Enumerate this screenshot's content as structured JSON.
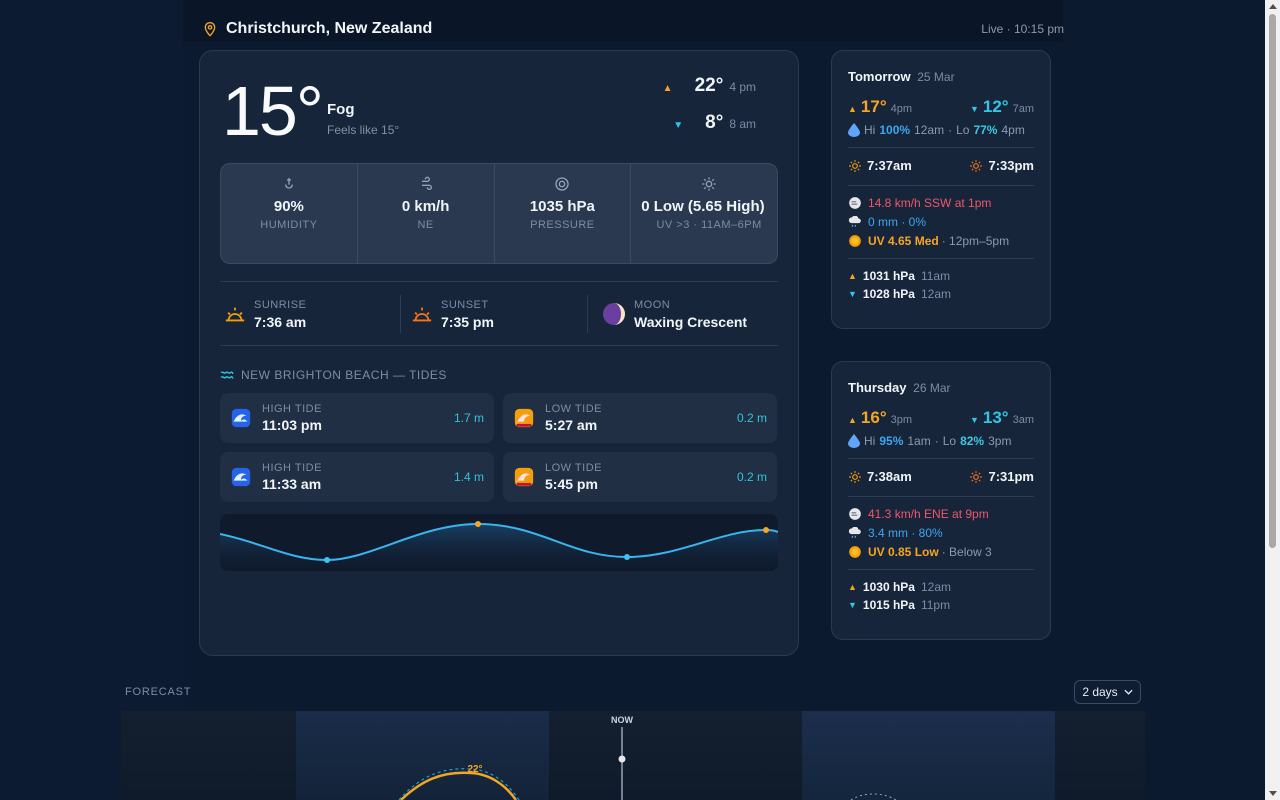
{
  "location": "Christchurch, New Zealand",
  "live": "Live · 10:15 pm",
  "current": {
    "temp": "15°",
    "condition": "Fog",
    "feels_like": "Feels like 15°",
    "high": {
      "temp": "22°",
      "time": "4 pm"
    },
    "low": {
      "temp": "8°",
      "time": "8 am"
    }
  },
  "stats": [
    {
      "value": "90%",
      "label": "HUMIDITY",
      "icon": "humidity-icon"
    },
    {
      "value": "0 km/h",
      "label": "NE",
      "icon": "wind-icon"
    },
    {
      "value": "1035 hPa",
      "label": "PRESSURE",
      "icon": "pressure-icon"
    },
    {
      "value": "0 Low (5.65 High)",
      "label": "UV >3 · 11AM–6PM",
      "icon": "uv-icon"
    }
  ],
  "astro": {
    "sunrise": {
      "label": "SUNRISE",
      "value": "7:36 am"
    },
    "sunset": {
      "label": "SUNSET",
      "value": "7:35 pm"
    },
    "moon": {
      "label": "MOON",
      "value": "Waxing Crescent"
    }
  },
  "tides": {
    "title": "NEW BRIGHTON BEACH — TIDES",
    "items": [
      {
        "label": "HIGH TIDE",
        "time": "11:03 pm",
        "height": "1.7 m"
      },
      {
        "label": "LOW TIDE",
        "time": "5:27 am",
        "height": "0.2 m"
      },
      {
        "label": "HIGH TIDE",
        "time": "11:33 am",
        "height": "1.4 m"
      },
      {
        "label": "LOW TIDE",
        "time": "5:45 pm",
        "height": "0.2 m"
      }
    ]
  },
  "days": [
    {
      "name": "Tomorrow",
      "date": "25 Mar",
      "high": "17°",
      "high_time": "4pm",
      "low": "12°",
      "low_time": "7am",
      "hum_hi_label": "Hi",
      "hum_hi": "100%",
      "hum_hi_time": "12am",
      "hum_lo_label": "Lo",
      "hum_lo": "77%",
      "hum_lo_time": "4pm",
      "sunrise": "7:37am",
      "sunset": "7:33pm",
      "wind": "14.8 km/h SSW at 1pm",
      "rain": "0 mm · 0%",
      "uv": "UV 4.65 Med",
      "uv_note": "· 12pm–5pm",
      "press_hi": "1031 hPa",
      "press_hi_time": "11am",
      "press_lo": "1028 hPa",
      "press_lo_time": "12am"
    },
    {
      "name": "Thursday",
      "date": "26 Mar",
      "high": "16°",
      "high_time": "3pm",
      "low": "13°",
      "low_time": "3am",
      "hum_hi_label": "Hi",
      "hum_hi": "95%",
      "hum_hi_time": "1am",
      "hum_lo_label": "Lo",
      "hum_lo": "82%",
      "hum_lo_time": "3pm",
      "sunrise": "7:38am",
      "sunset": "7:31pm",
      "wind": "41.3 km/h ENE at 9pm",
      "rain": "3.4 mm · 80%",
      "uv": "UV 0.85 Low",
      "uv_note": "· Below 3",
      "press_hi": "1030 hPa",
      "press_hi_time": "12am",
      "press_lo": "1015 hPa",
      "press_lo_time": "11pm"
    }
  ],
  "forecast": {
    "label": "FORECAST",
    "range": "2 days",
    "now_label": "NOW",
    "peak_label": "22°"
  },
  "colors": {
    "accent_warm": "#f5a524",
    "accent_cool": "#32c6e6",
    "wind_red": "#f0566a",
    "rain_blue": "#3da7ee"
  }
}
